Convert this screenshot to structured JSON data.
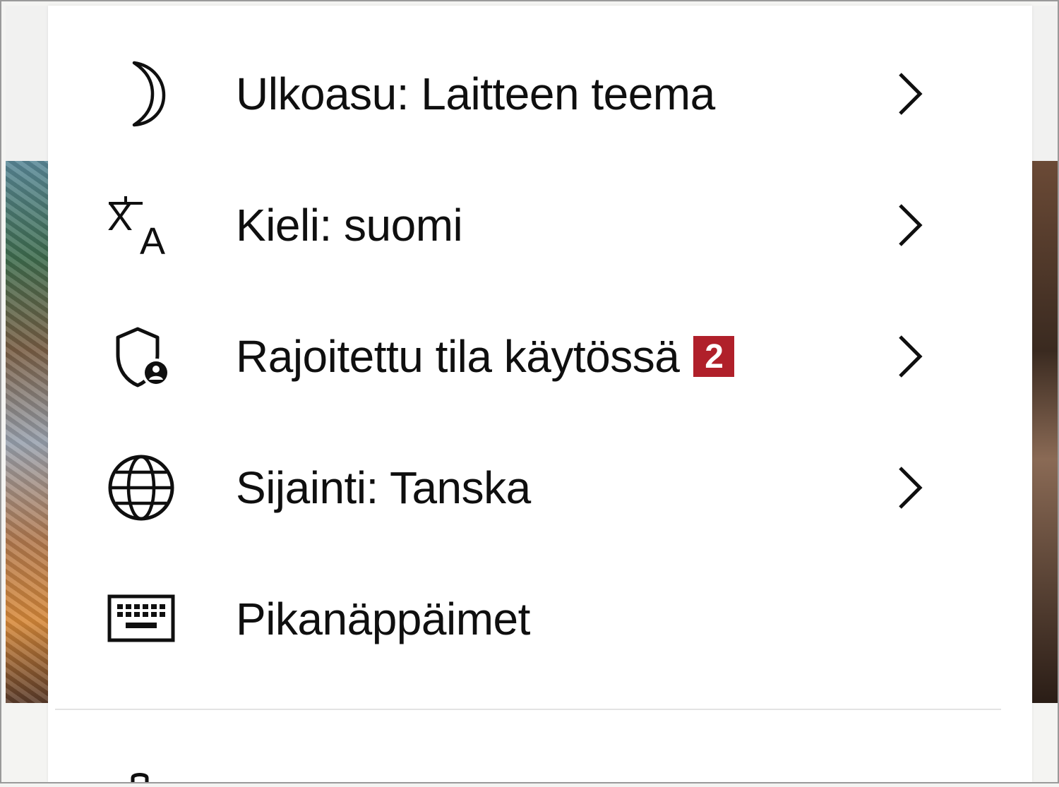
{
  "menu": {
    "items": [
      {
        "label": "Ulkoasu: Laitteen teema",
        "icon": "moon-icon",
        "has_submenu": true
      },
      {
        "label": "Kieli: suomi",
        "icon": "translate-icon",
        "has_submenu": true
      },
      {
        "label": "Rajoitettu tila käytössä",
        "icon": "shield-user-icon",
        "has_submenu": true,
        "badge": "2"
      },
      {
        "label": "Sijainti: Tanska",
        "icon": "globe-icon",
        "has_submenu": true
      },
      {
        "label": "Pikanäppäimet",
        "icon": "keyboard-icon",
        "has_submenu": false
      }
    ]
  },
  "colors": {
    "badge": "#b0202a",
    "menu_bg": "#ffffff",
    "text": "#0f0f0f"
  }
}
